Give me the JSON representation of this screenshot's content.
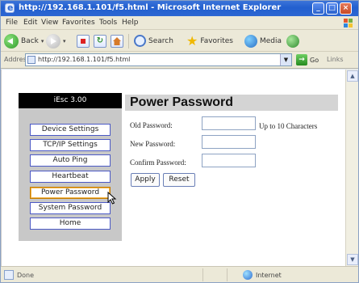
{
  "window": {
    "title": "http://192.168.1.101/f5.html - Microsoft Internet Explorer",
    "min_label": "_",
    "max_label": "□",
    "close_label": "×"
  },
  "menu": [
    "File",
    "Edit",
    "View",
    "Favorites",
    "Tools",
    "Help"
  ],
  "toolbar": {
    "back_label": "Back",
    "search_label": "Search",
    "favorites_label": "Favorites",
    "media_label": "Media"
  },
  "address": {
    "label": "Address",
    "url": "http://192.168.1.101/f5.html",
    "go_label": "Go",
    "links_label": "Links"
  },
  "sidebar": {
    "title": "iEsc 3.00",
    "items": [
      {
        "label": "Device Settings"
      },
      {
        "label": "TCP/IP Settings"
      },
      {
        "label": "Auto Ping"
      },
      {
        "label": "Heartbeat"
      },
      {
        "label": "Power Password"
      },
      {
        "label": "System Password"
      },
      {
        "label": "Home"
      }
    ],
    "active_item": "Power Password"
  },
  "page": {
    "title": "Power Password",
    "fields": [
      {
        "label": "Old Password:",
        "value": ""
      },
      {
        "label": "New Password:",
        "value": ""
      },
      {
        "label": "Confirm Password:",
        "value": ""
      }
    ],
    "hint": "Up to 10 Characters",
    "apply_label": "Apply",
    "reset_label": "Reset"
  },
  "status": {
    "text": "Done",
    "zone": "Internet"
  },
  "colors": {
    "titlebar": "#225fcf",
    "sidebar_bg": "#c8c8c8",
    "sidebar_head": "#000000",
    "nav_border": "#4b59c5",
    "title_bg": "#d4d4d4"
  }
}
